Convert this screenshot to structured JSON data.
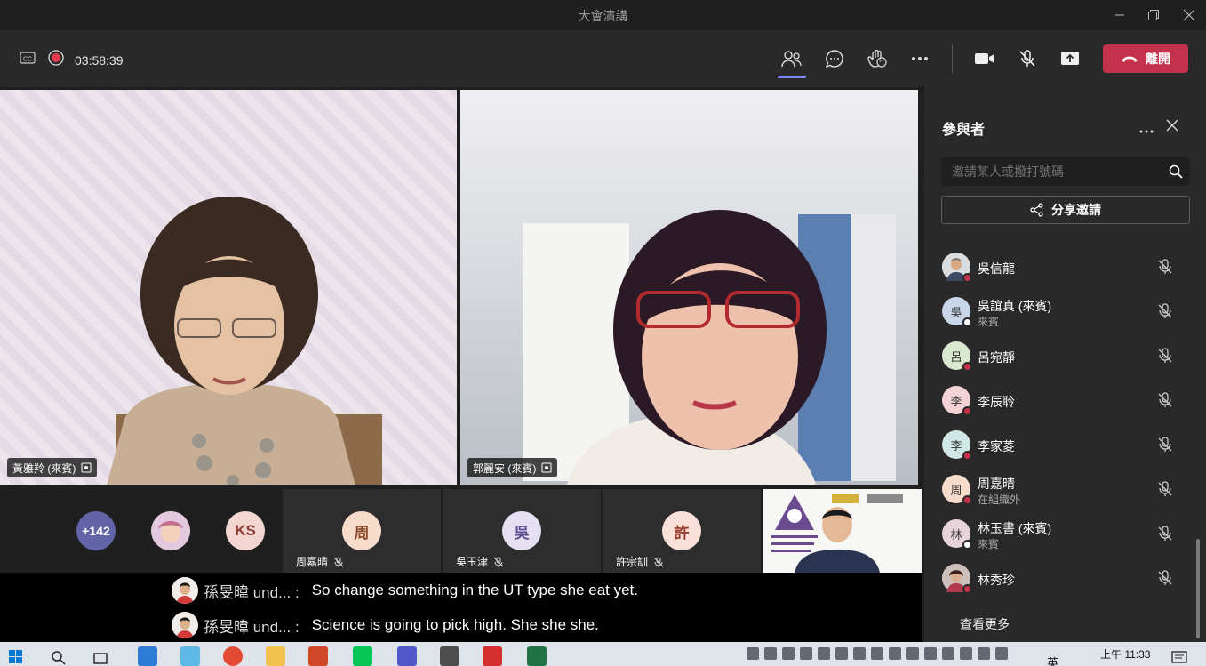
{
  "window": {
    "title": "大會演講"
  },
  "toolbar": {
    "timer": "03:58:39",
    "leave_label": "離開"
  },
  "colors": {
    "accent": "#7f85f5",
    "leave": "#c4314b",
    "panel": "#292929"
  },
  "videos": [
    {
      "name": "黃雅羚 (來賓)"
    },
    {
      "name": "郭麗安 (來賓)"
    }
  ],
  "strip": {
    "overflow_count": "+142",
    "ks_initials": "KS",
    "tiles": [
      {
        "initial": "周",
        "name": "周嘉晴"
      },
      {
        "initial": "吳",
        "name": "吳玉津"
      },
      {
        "initial": "許",
        "name": "許宗訓"
      }
    ]
  },
  "captions": [
    {
      "speaker": "孫旻暐 und... :",
      "text": "So change something in the UT type she eat yet."
    },
    {
      "speaker": "孫旻暐 und... :",
      "text": "Science is going to pick high. She she she."
    }
  ],
  "panel": {
    "title": "參與者",
    "search_placeholder": "邀請某人或撥打號碼",
    "share_label": "分享邀請",
    "see_more": "查看更多",
    "participants": [
      {
        "name": "吳信龍",
        "sub": "",
        "initial": "",
        "status": "#c4314b"
      },
      {
        "name": "吳誼真 (來賓)",
        "sub": "來賓",
        "initial": "吳",
        "status": "#ffffff"
      },
      {
        "name": "呂宛靜",
        "sub": "",
        "initial": "呂",
        "status": "#c4314b"
      },
      {
        "name": "李辰聆",
        "sub": "",
        "initial": "李",
        "status": "#c4314b"
      },
      {
        "name": "李家菱",
        "sub": "",
        "initial": "李",
        "status": "#c4314b"
      },
      {
        "name": "周嘉晴",
        "sub": "在組織外",
        "initial": "周",
        "status": "#c4314b"
      },
      {
        "name": "林玉書 (來賓)",
        "sub": "來賓",
        "initial": "林",
        "status": "#ffffff"
      },
      {
        "name": "林秀珍",
        "sub": "",
        "initial": "",
        "status": "#c4314b"
      }
    ]
  },
  "taskbar": {
    "ime": "英",
    "time": "上午 11:33"
  }
}
